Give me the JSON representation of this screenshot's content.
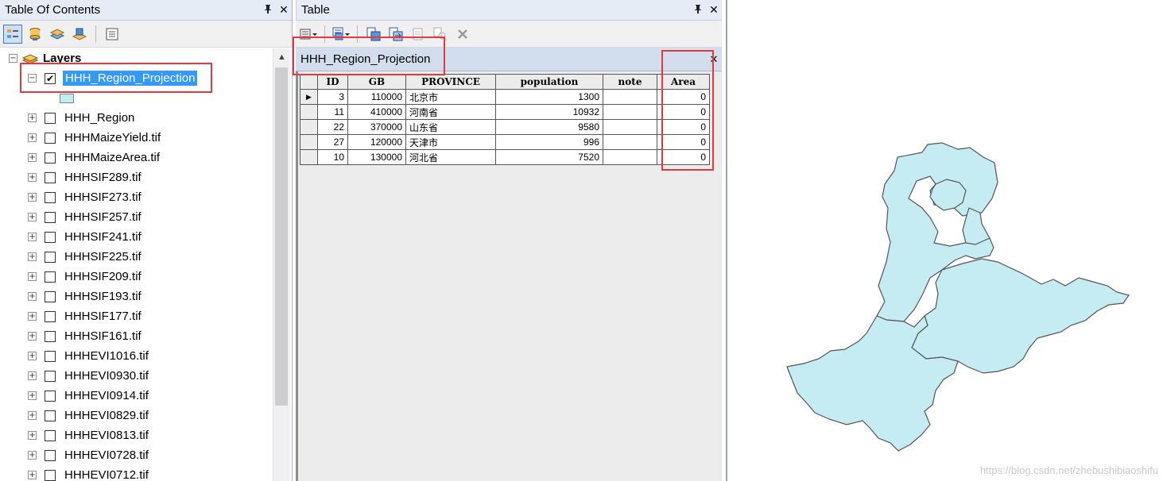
{
  "toc": {
    "title": "Table Of Contents",
    "pin_icon": "pin-icon",
    "close_glyph": "✕",
    "toolbar": [
      "list-by-drawing-order-icon",
      "list-by-source-icon",
      "list-by-visibility-icon",
      "list-by-selection-icon",
      "options-icon"
    ],
    "root_label": "Layers",
    "layers": [
      {
        "label": "HHH_Region_Projection",
        "checked": true,
        "expanded": true,
        "selected": true
      },
      {
        "label": "HHH_Region",
        "checked": false
      },
      {
        "label": "HHHMaizeYield.tif",
        "checked": false
      },
      {
        "label": "HHHMaizeArea.tif",
        "checked": false
      },
      {
        "label": "HHHSIF289.tif",
        "checked": false
      },
      {
        "label": "HHHSIF273.tif",
        "checked": false
      },
      {
        "label": "HHHSIF257.tif",
        "checked": false
      },
      {
        "label": "HHHSIF241.tif",
        "checked": false
      },
      {
        "label": "HHHSIF225.tif",
        "checked": false
      },
      {
        "label": "HHHSIF209.tif",
        "checked": false
      },
      {
        "label": "HHHSIF193.tif",
        "checked": false
      },
      {
        "label": "HHHSIF177.tif",
        "checked": false
      },
      {
        "label": "HHHSIF161.tif",
        "checked": false
      },
      {
        "label": "HHHEVI1016.tif",
        "checked": false
      },
      {
        "label": "HHHEVI0930.tif",
        "checked": false
      },
      {
        "label": "HHHEVI0914.tif",
        "checked": false
      },
      {
        "label": "HHHEVI0829.tif",
        "checked": false
      },
      {
        "label": "HHHEVI0813.tif",
        "checked": false
      },
      {
        "label": "HHHEVI0728.tif",
        "checked": false
      },
      {
        "label": "HHHEVI0712.tif",
        "checked": false
      }
    ]
  },
  "table": {
    "title": "Table",
    "tab_label": "HHH_Region_Projection",
    "columns": [
      "ID",
      "GB",
      "PROVINCE",
      "population",
      "note",
      "Area"
    ],
    "rows": [
      {
        "ID": "3",
        "GB": "110000",
        "PROVINCE": "北京市",
        "population": "1300",
        "note": "",
        "Area": "0"
      },
      {
        "ID": "11",
        "GB": "410000",
        "PROVINCE": "河南省",
        "population": "10932",
        "note": "",
        "Area": "0"
      },
      {
        "ID": "22",
        "GB": "370000",
        "PROVINCE": "山东省",
        "population": "9580",
        "note": "",
        "Area": "0"
      },
      {
        "ID": "27",
        "GB": "120000",
        "PROVINCE": "天津市",
        "population": "996",
        "note": "",
        "Area": "0"
      },
      {
        "ID": "10",
        "GB": "130000",
        "PROVINCE": "河北省",
        "population": "7520",
        "note": "",
        "Area": "0"
      }
    ]
  },
  "map": {
    "fill_color": "#c6ecf3",
    "stroke_color": "#555555",
    "watermark": "https://blog.csdn.net/zhebushibiaoshifu"
  },
  "colors": {
    "highlight": "#e8383d",
    "selection": "#3399ff"
  }
}
